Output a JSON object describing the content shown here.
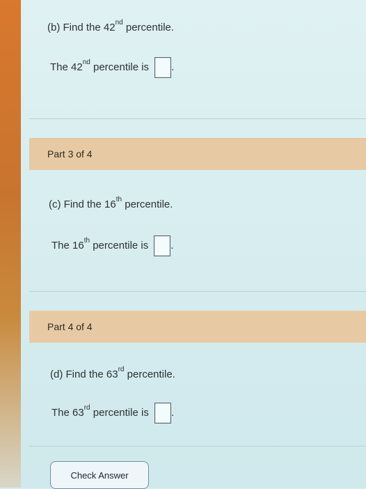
{
  "partB": {
    "prefix": "(b) Find the ",
    "ordinal": "42",
    "suffix": "nd",
    "tail": " percentile.",
    "answer_prefix": "The ",
    "answer_suffix_text": " percentile is ",
    "period": "."
  },
  "part3": {
    "label": "Part 3 of 4"
  },
  "partC": {
    "prefix": "(c) Find the ",
    "ordinal": "16",
    "suffix": "th",
    "tail": " percentile.",
    "answer_prefix": "The ",
    "answer_suffix_text": " percentile is ",
    "period": "."
  },
  "part4": {
    "label": "Part 4 of 4"
  },
  "partD": {
    "prefix": "(d) Find the ",
    "ordinal": "63",
    "suffix": "rd",
    "tail": " percentile.",
    "answer_prefix": "The ",
    "answer_suffix_text": " percentile is ",
    "period": "."
  },
  "footer": {
    "check_answer": "Check Answer"
  }
}
